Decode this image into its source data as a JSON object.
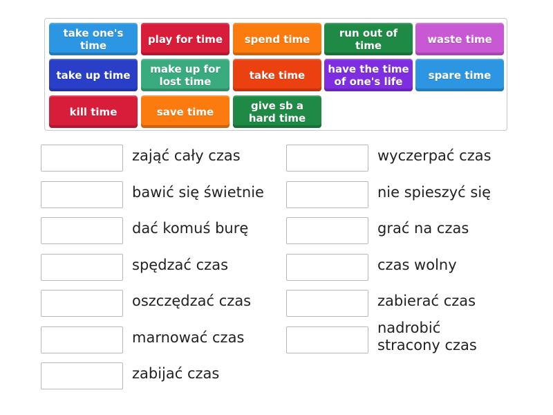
{
  "tiles": [
    {
      "label": "take one's time",
      "color": "#2c96e3"
    },
    {
      "label": "play for time",
      "color": "#d81d3b"
    },
    {
      "label": "spend time",
      "color": "#fb7b0f"
    },
    {
      "label": "run out of time",
      "color": "#1f8a45"
    },
    {
      "label": "waste time",
      "color": "#c958d4"
    },
    {
      "label": "take up time",
      "color": "#2a3fc7"
    },
    {
      "label": "make up for lost time",
      "color": "#3aab7e"
    },
    {
      "label": "take time",
      "color": "#eb4110"
    },
    {
      "label": "have the time of one's life",
      "color": "#7f2de0"
    },
    {
      "label": "spare time",
      "color": "#2c96e3"
    },
    {
      "label": "kill time",
      "color": "#d81d3b"
    },
    {
      "label": "save time",
      "color": "#fb7b0f"
    },
    {
      "label": "give sb a hard time",
      "color": "#1f8a45"
    }
  ],
  "targets": {
    "left": [
      "zająć cały czas",
      "bawić się świetnie",
      "dać komuś burę",
      "spędzać czas",
      "oszczędzać czas",
      "marnować czas",
      "zabijać czas"
    ],
    "right": [
      "wyczerpać czas",
      "nie spieszyć się",
      "grać na czas",
      "czas wolny",
      "zabierać czas",
      "nadrobić stracony czas"
    ]
  }
}
